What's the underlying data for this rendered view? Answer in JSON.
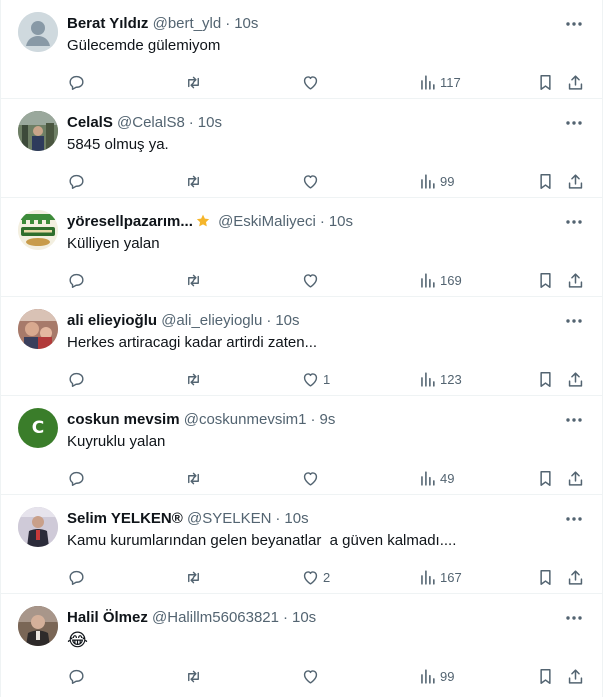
{
  "colors": {
    "text_primary": "#0f1419",
    "text_secondary": "#536471",
    "divider": "#eff3f4",
    "avatar_default": "#cfd9de",
    "avatar_coskun": "#3a7d2a"
  },
  "icons": {
    "reply": "reply-icon",
    "retweet": "retweet-icon",
    "like": "heart-icon",
    "views": "views-icon",
    "bookmark": "bookmark-icon",
    "share": "share-icon",
    "more": "more-icon"
  },
  "tweets": [
    {
      "name": "Berat Yıldız",
      "handle": "@bert_yld",
      "time": "10s",
      "text": "Gülecemde gülemiyom",
      "likes": "",
      "views": "117",
      "avatar": "default"
    },
    {
      "name": "CelalS",
      "handle": "@CelalS8",
      "time": "10s",
      "text": "5845 olmuş ya.",
      "likes": "",
      "views": "99",
      "avatar": "photo"
    },
    {
      "name": "yöresellpazarım...",
      "handle": "@EskiMaliyeci",
      "time": "10s",
      "text": "Külliyen yalan",
      "likes": "",
      "views": "169",
      "avatar": "logo",
      "badge": "gold-star-badge"
    },
    {
      "name": "ali elieyioğlu",
      "handle": "@ali_elieyioglu",
      "time": "10s",
      "text": "Herkes artiracagi kadar artirdi zaten...",
      "likes": "1",
      "views": "123",
      "avatar": "photo"
    },
    {
      "name": "coskun mevsim",
      "handle": "@coskunmevsim1",
      "time": "9s",
      "text": "Kuyruklu yalan",
      "likes": "",
      "views": "49",
      "avatar": "letter",
      "avatar_letter": "C"
    },
    {
      "name": "Selim YELKEN®",
      "handle": "@SYELKEN",
      "time": "10s",
      "text": "Kamu kurumlarından gelen beyanatlar  a güven kalmadı....",
      "likes": "2",
      "views": "167",
      "avatar": "photo"
    },
    {
      "name": "Halil Ölmez",
      "handle": "@Halillm56063821",
      "time": "10s",
      "text": "😂",
      "likes": "",
      "views": "99",
      "avatar": "photo"
    }
  ]
}
